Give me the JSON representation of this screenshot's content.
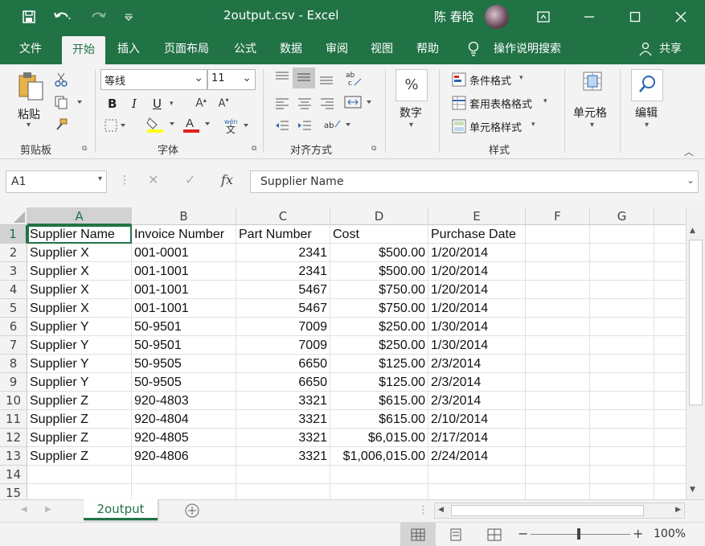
{
  "title_bar": {
    "doc_title": "2output.csv  -  Excel",
    "user_name": "陈 春晗"
  },
  "menu": {
    "tabs": [
      "文件",
      "开始",
      "插入",
      "页面布局",
      "公式",
      "数据",
      "审阅",
      "视图",
      "帮助"
    ],
    "tell_me": "操作说明搜索",
    "share": "共享"
  },
  "ribbon": {
    "clipboard": {
      "paste": "粘贴",
      "label": "剪贴板"
    },
    "font": {
      "name": "等线",
      "size": "11",
      "label": "字体",
      "bold": "B",
      "italic": "I",
      "underline": "U"
    },
    "alignment": {
      "label": "对齐方式"
    },
    "number": {
      "button": "数字",
      "percent": "%"
    },
    "styles": {
      "conditional": "条件格式",
      "table": "套用表格格式",
      "cell_styles": "单元格样式",
      "label": "样式"
    },
    "cells": {
      "button": "单元格"
    },
    "editing": {
      "button": "编辑"
    }
  },
  "formula_bar": {
    "name_box": "A1",
    "fx": "fx",
    "content": "Supplier Name"
  },
  "sheet": {
    "columns": [
      "A",
      "B",
      "C",
      "D",
      "E",
      "F",
      "G"
    ],
    "rows": [
      [
        "Supplier Name",
        "Invoice Number",
        "Part Number",
        "Cost",
        "Purchase Date"
      ],
      [
        "Supplier X",
        "001-0001",
        "2341",
        "$500.00",
        "1/20/2014"
      ],
      [
        "Supplier X",
        "001-1001",
        "2341",
        "$500.00",
        "1/20/2014"
      ],
      [
        "Supplier X",
        "001-1001",
        "5467",
        "$750.00",
        "1/20/2014"
      ],
      [
        "Supplier X",
        "001-1001",
        "5467",
        "$750.00",
        "1/20/2014"
      ],
      [
        "Supplier Y",
        "50-9501",
        "7009",
        "$250.00",
        "1/30/2014"
      ],
      [
        "Supplier Y",
        "50-9501",
        "7009",
        "$250.00",
        "1/30/2014"
      ],
      [
        "Supplier Y",
        "50-9505",
        "6650",
        "$125.00",
        "2/3/2014"
      ],
      [
        "Supplier Y",
        "50-9505",
        "6650",
        "$125.00",
        "2/3/2014"
      ],
      [
        "Supplier Z",
        "920-4803",
        "3321",
        "$615.00",
        "2/3/2014"
      ],
      [
        "Supplier Z",
        "920-4804",
        "3321",
        "$615.00",
        "2/10/2014"
      ],
      [
        "Supplier Z",
        "920-4805",
        "3321",
        "$6,015.00",
        "2/17/2014"
      ],
      [
        "Supplier Z",
        "920-4806",
        "3321",
        "$1,006,015.00",
        "2/24/2014"
      ]
    ],
    "row_numbers": [
      "1",
      "2",
      "3",
      "4",
      "5",
      "6",
      "7",
      "8",
      "9",
      "10",
      "11",
      "12",
      "13",
      "14",
      "15"
    ],
    "tab_name": "2output"
  },
  "status_bar": {
    "zoom": "100%"
  },
  "colors": {
    "excel_green": "#217346"
  }
}
